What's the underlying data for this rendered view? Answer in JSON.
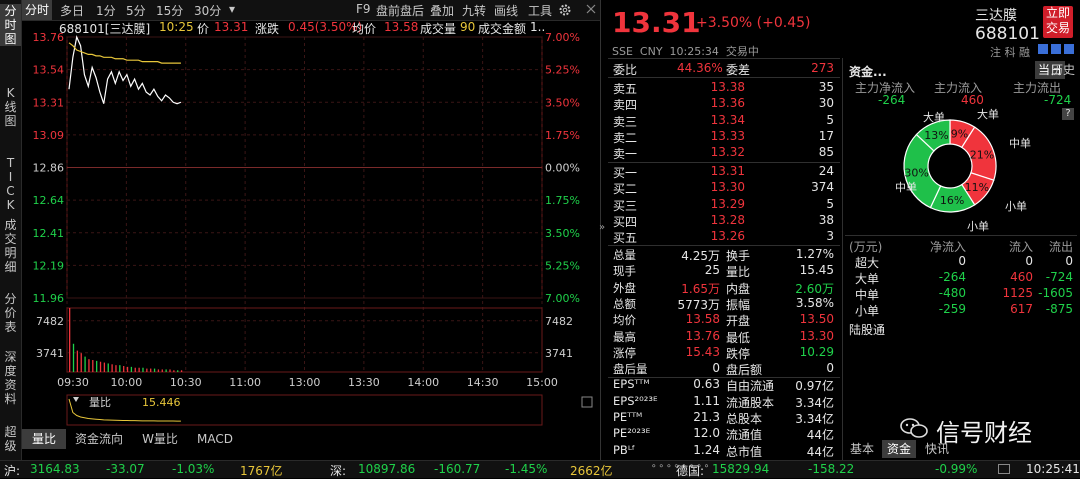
{
  "left_tabs": [
    "分时图",
    "K线图",
    "TICK",
    "成交明细",
    "分价表",
    "深度资料",
    "超级"
  ],
  "toolbar": {
    "items": [
      "分时",
      "多日",
      "1分",
      "5分",
      "15分",
      "30分",
      "▾"
    ],
    "right_items": [
      "F9",
      "盘前盘后",
      "叠加",
      "九转",
      "画线",
      "工具"
    ]
  },
  "info": {
    "code": "688101[三达膜]",
    "time": "10:25",
    "price_label": "价",
    "price": "13.31",
    "change_label": "涨跌",
    "change": "0.45(3.50%)",
    "avg_label": "均价",
    "avg": "13.58",
    "vol_label": "成交量",
    "vol": "90",
    "amt_label": "成交金额",
    "amt": "1.."
  },
  "chart_data": {
    "type": "line",
    "price_axis_left": [
      "13.76",
      "13.54",
      "13.31",
      "13.09",
      "12.86",
      "12.64",
      "12.41",
      "12.19",
      "11.96"
    ],
    "price_axis_right": [
      "7.00%",
      "5.25%",
      "3.50%",
      "1.75%",
      "0.00%",
      "1.75%",
      "3.50%",
      "5.25%",
      "7.00%"
    ],
    "vol_axis_left": [
      "7482",
      "3741"
    ],
    "vol_axis_right": [
      "7482",
      "3741"
    ],
    "x_labels": [
      "09:30",
      "10:00",
      "10:30",
      "11:00",
      "13:00",
      "13:30",
      "14:00",
      "14:30",
      "15:00"
    ],
    "ylim": [
      11.96,
      13.76
    ],
    "series": [
      {
        "values": [
          13.4,
          13.62,
          13.76,
          13.7,
          13.5,
          13.42,
          13.55,
          13.48,
          13.38,
          13.3,
          13.47,
          13.52,
          13.44,
          13.52,
          13.46,
          13.5,
          13.42,
          13.47,
          13.4,
          13.44,
          13.38,
          13.36,
          13.4,
          13.35,
          13.32,
          13.36,
          13.34,
          13.31,
          13.3,
          13.31
        ]
      },
      {
        "values": [
          13.72,
          13.7,
          13.67,
          13.66,
          13.65,
          13.64,
          13.64,
          13.63,
          13.63,
          13.62,
          13.62,
          13.62,
          13.61,
          13.61,
          13.61,
          13.6,
          13.6,
          13.6,
          13.6,
          13.59,
          13.59,
          13.59,
          13.59,
          13.59,
          13.58,
          13.58,
          13.58,
          13.58,
          13.58,
          13.58
        ]
      }
    ],
    "volume": [
      7600,
      3300,
      2500,
      2200,
      1800,
      1500,
      1400,
      1300,
      1200,
      1100,
      1000,
      900,
      800,
      800,
      700,
      600,
      600,
      500,
      500,
      500,
      400,
      400,
      400,
      300,
      300,
      300,
      300,
      200,
      200,
      200
    ],
    "vol_max": 7482,
    "ratio_label": "量比",
    "ratio_value": "15.446",
    "ratio_series": [
      32,
      14,
      10,
      8,
      7,
      6,
      5.5,
      5,
      4.6,
      4.2,
      4,
      3.8,
      3.6,
      3.5,
      3.4,
      3.3,
      3.2,
      3.1,
      3,
      2.9,
      2.9,
      2.8,
      2.8,
      2.7,
      2.7,
      2.6,
      2.6,
      2.6,
      2.5,
      2.5
    ]
  },
  "bottom_tabs": [
    "量比",
    "资金流向",
    "W量比",
    "MACD"
  ],
  "header": {
    "price": "13.31",
    "change": "+3.50% (+0.45)",
    "meta": "SSE  CNY  10:25:34  交易中",
    "name": "三达膜",
    "code": "688101",
    "flags": "注 科 融",
    "buy_button": "立即交易"
  },
  "orderbook": {
    "weibi_label": "委比",
    "weibi": "44.36%",
    "weicha_label": "委差",
    "weicha": "273",
    "asks": [
      {
        "label": "卖五",
        "price": "13.38",
        "vol": "35"
      },
      {
        "label": "卖四",
        "price": "13.36",
        "vol": "30"
      },
      {
        "label": "卖三",
        "price": "13.34",
        "vol": "5"
      },
      {
        "label": "卖二",
        "price": "13.33",
        "vol": "17"
      },
      {
        "label": "卖一",
        "price": "13.32",
        "vol": "85"
      }
    ],
    "bids": [
      {
        "label": "买一",
        "price": "13.31",
        "vol": "24"
      },
      {
        "label": "买二",
        "price": "13.30",
        "vol": "374"
      },
      {
        "label": "买三",
        "price": "13.29",
        "vol": "5"
      },
      {
        "label": "买四",
        "price": "13.28",
        "vol": "38"
      },
      {
        "label": "买五",
        "price": "13.26",
        "vol": "3"
      }
    ]
  },
  "stats": [
    [
      {
        "l": "总量",
        "v": "4.25万",
        "c": "wht"
      },
      {
        "l": "换手",
        "v": "1.27%",
        "c": "wht"
      }
    ],
    [
      {
        "l": "现手",
        "v": "25",
        "c": "wht"
      },
      {
        "l": "量比",
        "v": "15.45",
        "c": "wht"
      }
    ],
    [
      {
        "l": "外盘",
        "v": "1.65万",
        "c": "red"
      },
      {
        "l": "内盘",
        "v": "2.60万",
        "c": "green"
      }
    ],
    [
      {
        "l": "总额",
        "v": "5773万",
        "c": "wht"
      },
      {
        "l": "振幅",
        "v": "3.58%",
        "c": "wht"
      }
    ],
    [
      {
        "l": "均价",
        "v": "13.58",
        "c": "red"
      },
      {
        "l": "开盘",
        "v": "13.50",
        "c": "red"
      }
    ],
    [
      {
        "l": "最高",
        "v": "13.76",
        "c": "red"
      },
      {
        "l": "最低",
        "v": "13.30",
        "c": "red"
      }
    ],
    [
      {
        "l": "涨停",
        "v": "15.43",
        "c": "red"
      },
      {
        "l": "跌停",
        "v": "10.29",
        "c": "green"
      }
    ],
    [
      {
        "l": "盘后量",
        "v": "0",
        "c": "wht"
      },
      {
        "l": "盘后额",
        "v": "0",
        "c": "wht"
      }
    ],
    [
      {
        "l": "EPSᵀᵀᴹ",
        "v": "0.63",
        "c": "wht"
      },
      {
        "l": "自由流通",
        "v": "0.97亿",
        "c": "wht"
      }
    ],
    [
      {
        "l": "EPS²⁰²³ᴱ",
        "v": "1.11",
        "c": "wht"
      },
      {
        "l": "流通股本",
        "v": "3.34亿",
        "c": "wht"
      }
    ],
    [
      {
        "l": "PEᵀᵀᴹ",
        "v": "21.3",
        "c": "wht"
      },
      {
        "l": "总股本",
        "v": "3.34亿",
        "c": "wht"
      }
    ],
    [
      {
        "l": "PE²⁰²³ᴱ",
        "v": "12.0",
        "c": "wht"
      },
      {
        "l": "流通值",
        "v": "44亿",
        "c": "wht"
      }
    ],
    [
      {
        "l": "PBᴸᶠ",
        "v": "1.24",
        "c": "wht"
      },
      {
        "l": "总市值",
        "v": "44亿",
        "c": "wht"
      }
    ]
  ],
  "fund": {
    "title": "资金...",
    "tab_today": "当日",
    "tab_history": "历史",
    "heads": [
      "主力净流入",
      "主力流入",
      "主力流出"
    ],
    "values": [
      "-264",
      "460",
      "-724"
    ],
    "help": "?",
    "donut": [
      {
        "label": "大单",
        "pct": "9%",
        "value": 9,
        "color": "#f0343c"
      },
      {
        "label": "中单",
        "pct": "21%",
        "value": 21,
        "color": "#f0343c"
      },
      {
        "label": "小单",
        "pct": "11%",
        "value": 11,
        "color": "#f0343c"
      },
      {
        "label": "小单",
        "pct": "16%",
        "value": 16,
        "color": "#1fc04a"
      },
      {
        "label": "中单",
        "pct": "30%",
        "value": 30,
        "color": "#1fc04a"
      },
      {
        "label": "大单",
        "pct": "13%",
        "value": 13,
        "color": "#1fc04a"
      }
    ],
    "table_head": [
      "(万元)",
      "净流入",
      "流入",
      "流出"
    ],
    "table_rows": [
      [
        "超大",
        "0",
        "0",
        "0"
      ],
      [
        "大单",
        "-264",
        "460",
        "-724"
      ],
      [
        "中单",
        "-480",
        "1125",
        "-1605"
      ],
      [
        "小单",
        "-259",
        "617",
        "-875"
      ]
    ],
    "lugu": "陆股通",
    "watermark": "信号财经",
    "bottom_tabs": [
      "基本",
      "资金",
      "快讯"
    ]
  },
  "status": {
    "sh_label": "沪:",
    "sh_val": "3164.83",
    "sh_chg": "-33.07",
    "sh_pct": "-1.03%",
    "sh_amt": "1767亿",
    "sz_label": "深:",
    "sz_val": "10897.86",
    "sz_chg": "-160.77",
    "sz_pct": "-1.45%",
    "sz_amt": "2662亿",
    "de_label": "德国:",
    "de_val": "15829.94",
    "de_chg": "-158.22",
    "de_pct": "-0.99%",
    "time": "10:25:41"
  }
}
